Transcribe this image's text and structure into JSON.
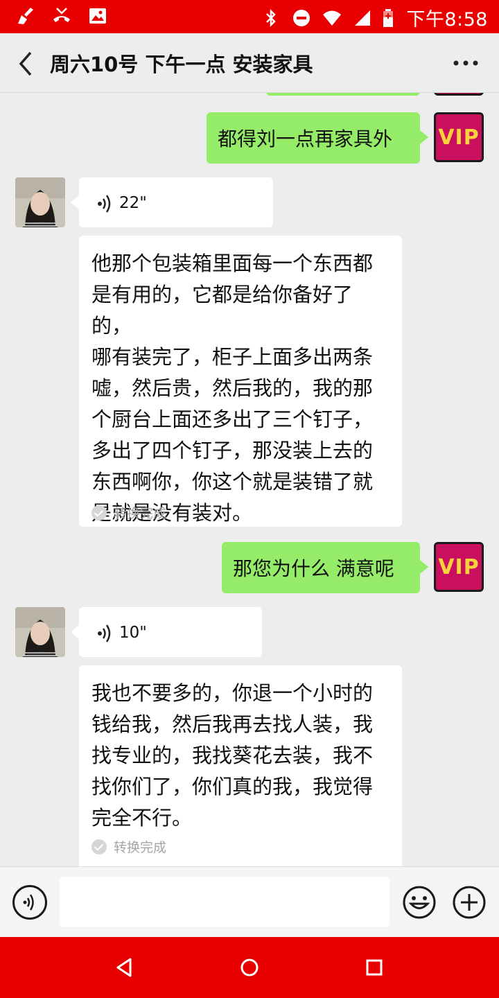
{
  "status_bar": {
    "time": "下午8:58",
    "left_icons": [
      "broom-icon",
      "missed-call-icon",
      "image-icon"
    ],
    "right_icons": [
      "bluetooth-icon",
      "do-not-disturb-icon",
      "wifi-icon",
      "signal-icon",
      "battery-icon"
    ]
  },
  "header": {
    "title": "周六10号 下午一点 安装家具",
    "back_icon": "back-chevron-icon",
    "more_icon": "more-dots-icon"
  },
  "messages": [
    {
      "direction": "out",
      "type": "text",
      "text": "都得刘一点再家具外",
      "avatar_label": "VIP"
    },
    {
      "direction": "in",
      "type": "voice",
      "duration": "22\"",
      "transcript": "他那个包装箱里面每一个东西都是有用的，它都是给你备好了的，哪有装完了，柜子上面多出两条嘘，然后贵，然后我的，我的那个厨台上面还多出了三个钉子，多出了四个钉子，那没装上去的东西啊你，你这个就是装错了就是就是没有装对。",
      "transcript_lines": [
        "他那个包装箱里面每一个东西都",
        "是有用的，它都是给你备好了的，",
        "哪有装完了，柜子上面多出两条",
        "嘘，然后贵，然后我的，我的那",
        "个厨台上面还多出了三个钉子，",
        "多出了四个钉子，那没装上去的",
        "东西啊你，你这个就是装错了就",
        "是就是没有装对。"
      ],
      "status": "转换完成"
    },
    {
      "direction": "out",
      "type": "text",
      "text": "那您为什么 满意呢",
      "avatar_label": "VIP"
    },
    {
      "direction": "in",
      "type": "voice",
      "duration": "10\"",
      "transcript_lines": [
        "我也不要多的，你退一个小时的",
        "钱给我，然后我再去找人装，我",
        "找专业的，我找葵花去装，我不",
        "找你们了，你们真的我，我觉得",
        "完全不行。"
      ],
      "status": "转换完成"
    }
  ],
  "input_bar": {
    "voice_icon": "voice-input-icon",
    "text_value": "",
    "emoji_icon": "emoji-icon",
    "plus_icon": "plus-icon"
  },
  "nav_bar": {
    "icons": [
      "nav-back-icon",
      "nav-home-icon",
      "nav-recents-icon"
    ]
  },
  "colors": {
    "status_bar": "#e80000",
    "outgoing_bubble": "#95ec69",
    "incoming_bubble": "#ffffff",
    "chat_bg": "#ededed",
    "vip_bg": "#c8105e",
    "vip_text": "#f7d23a"
  }
}
